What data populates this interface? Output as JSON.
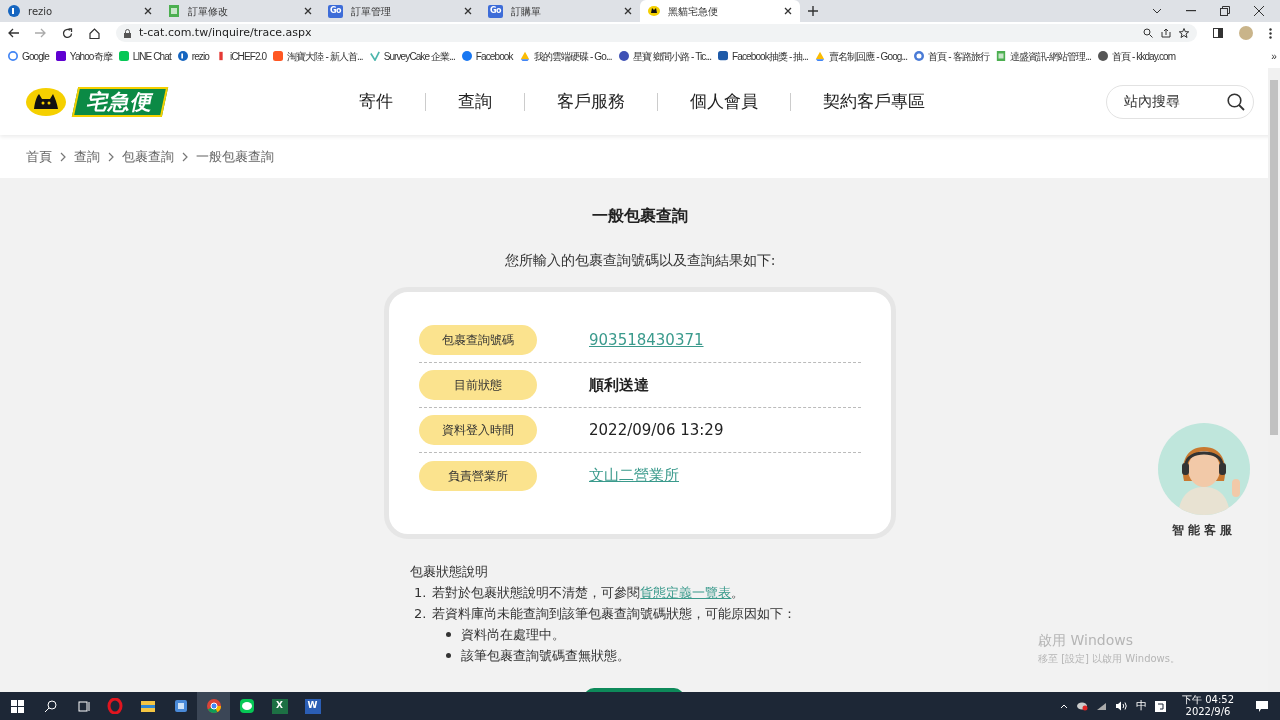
{
  "browser": {
    "tabs": [
      {
        "title": "rezio",
        "selected": false
      },
      {
        "title": "訂單修改",
        "selected": false
      },
      {
        "title": "訂單管理",
        "icon_text": "Go",
        "selected": false
      },
      {
        "title": "訂購單",
        "icon_text": "Go",
        "selected": false
      },
      {
        "title": "黑貓宅急便",
        "selected": true
      }
    ],
    "address": "t-cat.com.tw/inquire/trace.aspx",
    "bookmarks": [
      {
        "title": "Google"
      },
      {
        "title": "Yahoo奇摩"
      },
      {
        "title": "LINE Chat"
      },
      {
        "title": "rezio"
      },
      {
        "title": "iCHEF2.0"
      },
      {
        "title": "淘寶大陸 - 新人首..."
      },
      {
        "title": "SurveyCake 企業..."
      },
      {
        "title": "Facebook"
      },
      {
        "title": "我的雲端硬碟 - Go..."
      },
      {
        "title": "星寶 鄉間小路 - Tic..."
      },
      {
        "title": "Facebook抽獎 - 抽..."
      },
      {
        "title": "賣名制回應 - Goog..."
      },
      {
        "title": "首頁 - 客路旅行"
      },
      {
        "title": "達盛資訊-網站管理..."
      },
      {
        "title": "首頁 - kkday.com"
      }
    ],
    "more": "»"
  },
  "site": {
    "logo": "宅急便",
    "nav": [
      "寄件",
      "查詢",
      "客戶服務",
      "個人會員",
      "契約客戶專區"
    ],
    "search": {
      "placeholder": "站內搜尋"
    }
  },
  "breadcrumb": [
    "首頁",
    "查詢",
    "包裹查詢",
    "一般包裹查詢"
  ],
  "page": {
    "title": "一般包裹查詢",
    "intro": "您所輸入的包裹查詢號碼以及查詢結果如下:",
    "results": [
      {
        "label": "包裹查詢號碼",
        "value": "903518430371",
        "kind": "link"
      },
      {
        "label": "目前狀態",
        "value": "順利送達",
        "kind": "bold"
      },
      {
        "label": "資料登入時間",
        "value": "2022/09/06 13:29",
        "kind": "text"
      },
      {
        "label": "負責營業所",
        "value": "文山二營業所",
        "kind": "link"
      }
    ],
    "notes": {
      "title": "包裹狀態說明",
      "items": [
        {
          "number": "1.",
          "text": "若對於包裹狀態說明不清楚，可參閱",
          "link": "貨態定義一覽表",
          "after": "。"
        },
        {
          "number": "2.",
          "text": "若資料庫尚未能查詢到該筆包裹查詢號碼狀態，可能原因如下：",
          "children": [
            "資料尚在處理中。",
            "該筆包裹查詢號碼查無狀態。"
          ]
        }
      ]
    }
  },
  "chatbot": {
    "label": "智能客服"
  },
  "activation": {
    "title": "啟用 Windows",
    "subtitle": "移至 [設定] 以啟用 Windows。"
  },
  "taskbar": {
    "apps": [
      {
        "kind": "opera",
        "active": false
      },
      {
        "kind": "explorer",
        "active": false
      },
      {
        "kind": "app",
        "active": false
      },
      {
        "kind": "chrome",
        "active": true
      },
      {
        "kind": "line",
        "active": false
      },
      {
        "kind": "excel",
        "letter": "X",
        "active": false
      },
      {
        "kind": "word",
        "letter": "W",
        "active": false
      }
    ],
    "ime": "中",
    "time": "下午 04:52",
    "date": "2022/9/6"
  }
}
